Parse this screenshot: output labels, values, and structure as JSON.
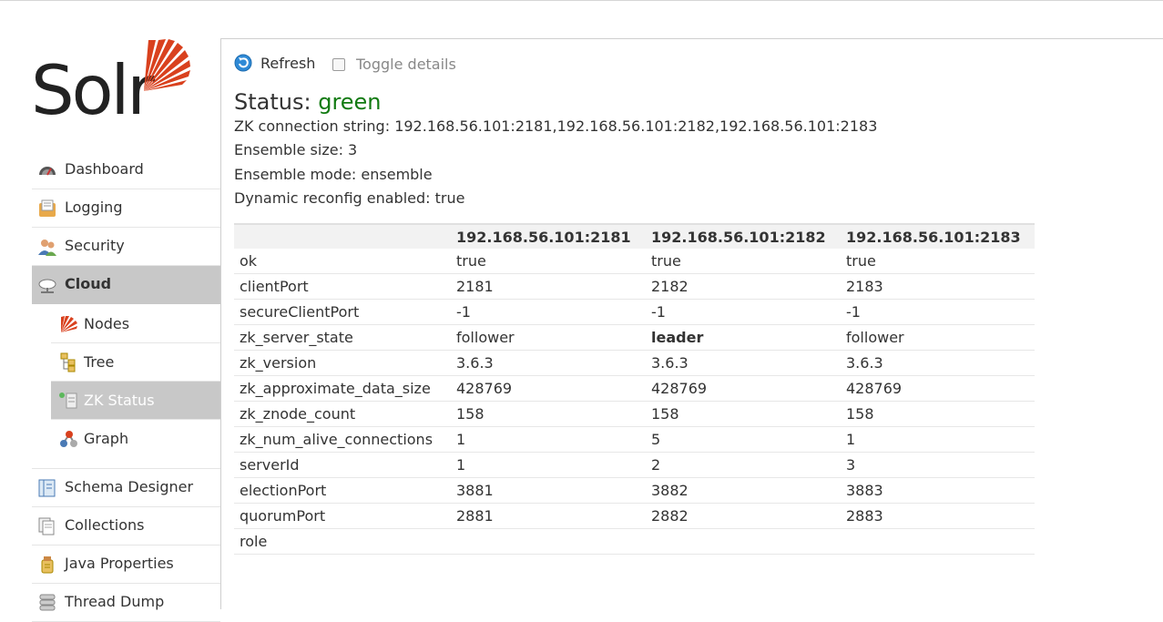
{
  "logo": {
    "text": "Solr"
  },
  "sidebar": {
    "items": [
      {
        "label": "Dashboard",
        "icon": "dashboard-icon"
      },
      {
        "label": "Logging",
        "icon": "logging-icon"
      },
      {
        "label": "Security",
        "icon": "security-icon"
      },
      {
        "label": "Cloud",
        "icon": "cloud-icon"
      }
    ],
    "cloud_sub": [
      {
        "label": "Nodes",
        "icon": "nodes-icon"
      },
      {
        "label": "Tree",
        "icon": "tree-icon"
      },
      {
        "label": "ZK Status",
        "icon": "zk-status-icon"
      },
      {
        "label": "Graph",
        "icon": "graph-icon"
      }
    ],
    "items_after": [
      {
        "label": "Schema Designer",
        "icon": "schema-designer-icon"
      },
      {
        "label": "Collections",
        "icon": "collections-icon"
      },
      {
        "label": "Java Properties",
        "icon": "java-properties-icon"
      },
      {
        "label": "Thread Dump",
        "icon": "thread-dump-icon"
      }
    ]
  },
  "toolbar": {
    "refresh_label": "Refresh",
    "toggle_label": "Toggle details"
  },
  "status": {
    "prefix": "Status:",
    "value": "green",
    "value_color": "#117a11",
    "lines": [
      "ZK connection string: 192.168.56.101:2181,192.168.56.101:2182,192.168.56.101:2183",
      "Ensemble size: 3",
      "Ensemble mode: ensemble",
      "Dynamic reconfig enabled: true"
    ]
  },
  "table": {
    "headers": [
      "",
      "192.168.56.101:2181",
      "192.168.56.101:2182",
      "192.168.56.101:2183"
    ],
    "rows": [
      [
        "ok",
        "true",
        "true",
        "true"
      ],
      [
        "clientPort",
        "2181",
        "2182",
        "2183"
      ],
      [
        "secureClientPort",
        "-1",
        "-1",
        "-1"
      ],
      [
        "zk_server_state",
        "follower",
        "leader",
        "follower"
      ],
      [
        "zk_version",
        "3.6.3",
        "3.6.3",
        "3.6.3"
      ],
      [
        "zk_approximate_data_size",
        "428769",
        "428769",
        "428769"
      ],
      [
        "zk_znode_count",
        "158",
        "158",
        "158"
      ],
      [
        "zk_num_alive_connections",
        "1",
        "5",
        "1"
      ],
      [
        "serverId",
        "1",
        "2",
        "3"
      ],
      [
        "electionPort",
        "3881",
        "3882",
        "3883"
      ],
      [
        "quorumPort",
        "2881",
        "2882",
        "2883"
      ],
      [
        "role",
        "",
        "",
        ""
      ]
    ]
  },
  "colors": {
    "accent": "#d9411e",
    "active_bg": "#c8c8c8"
  }
}
